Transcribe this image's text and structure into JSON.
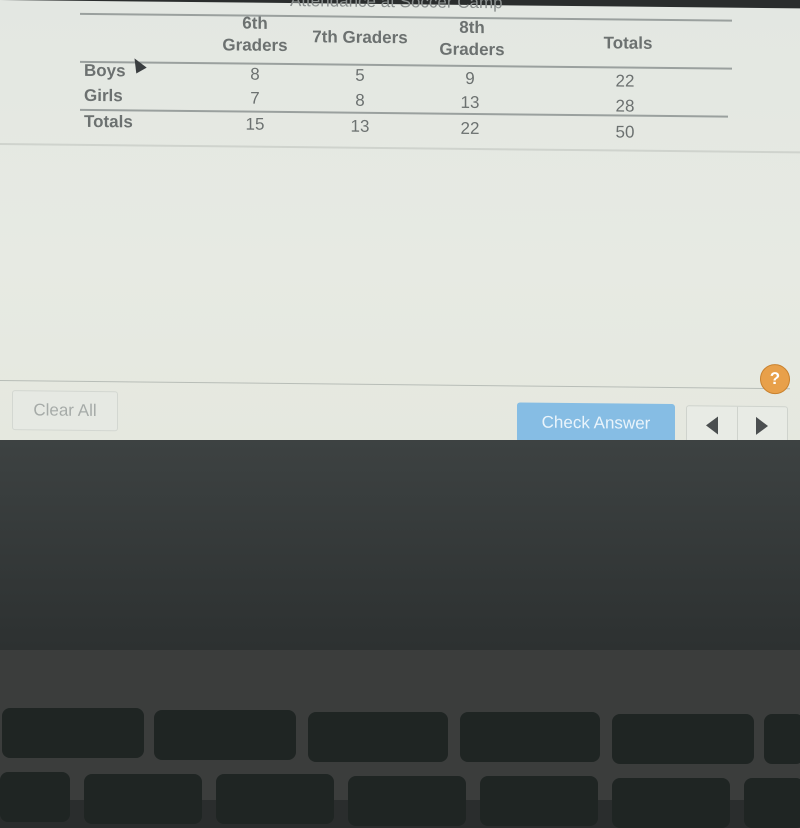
{
  "table": {
    "title": "Attendance at Soccer Camp",
    "columns": [
      "6th Graders",
      "7th Graders",
      "8th Graders",
      "Totals"
    ],
    "column_lines": [
      [
        "6th",
        "Graders"
      ],
      [
        "7th Graders"
      ],
      [
        "8th",
        "Graders"
      ],
      [
        "Totals"
      ]
    ],
    "rows": [
      {
        "label": "Boys",
        "values": [
          "8",
          "5",
          "9",
          "22"
        ]
      },
      {
        "label": "Girls",
        "values": [
          "7",
          "8",
          "13",
          "28"
        ]
      },
      {
        "label": "Totals",
        "values": [
          "15",
          "13",
          "22",
          "50"
        ]
      }
    ]
  },
  "footer": {
    "clear_all": "Clear All",
    "check_answer": "Check Answer",
    "help": "?"
  },
  "colors": {
    "check_button": "#86bde4",
    "help_badge": "#e8a04a"
  }
}
